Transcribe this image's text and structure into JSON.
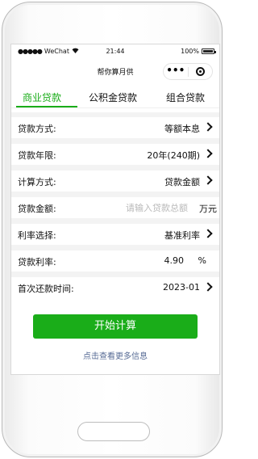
{
  "status_bar": {
    "signal": "●●●●●",
    "carrier": "WeChat",
    "wifi_icon": "wifi-icon",
    "time": "21:44",
    "battery_percent": "100%"
  },
  "nav": {
    "title": "帮你算月供",
    "more_icon": "more-dots-icon",
    "close_icon": "close-circle-icon"
  },
  "tabs": [
    {
      "label": "商业贷款",
      "active": true
    },
    {
      "label": "公积金贷款",
      "active": false
    },
    {
      "label": "组合贷款",
      "active": false
    }
  ],
  "form": {
    "loan_method": {
      "label": "贷款方式:",
      "value": "等额本息"
    },
    "loan_term": {
      "label": "贷款年限:",
      "value": "20年(240期)"
    },
    "calc_method": {
      "label": "计算方式:",
      "value": "贷款金额"
    },
    "loan_amount": {
      "label": "贷款金额:",
      "placeholder": "请输入贷款总额",
      "value": "",
      "unit": "万元"
    },
    "rate_choice": {
      "label": "利率选择:",
      "value": "基准利率"
    },
    "loan_rate": {
      "label": "贷款利率:",
      "value": "4.90",
      "unit": "%"
    },
    "first_payment": {
      "label": "首次还款时间:",
      "value": "2023-01"
    }
  },
  "actions": {
    "calculate": "开始计算",
    "more_info": "点击查看更多信息"
  },
  "colors": {
    "accent": "#1aad19",
    "link": "#576b95",
    "placeholder": "#b9b9b9"
  }
}
